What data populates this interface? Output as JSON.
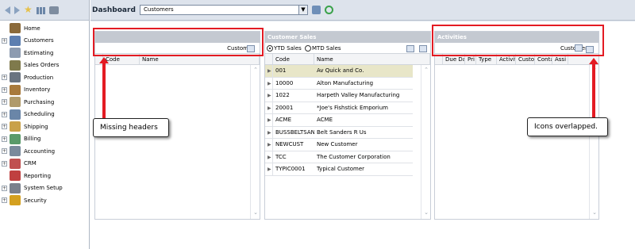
{
  "nav": {
    "items": [
      {
        "label": "Home",
        "expandable": false,
        "icon": "home-icon",
        "color": "#8b6a3a"
      },
      {
        "label": "Customers",
        "expandable": true,
        "icon": "customers-icon",
        "color": "#5e7fb0"
      },
      {
        "label": "Estimating",
        "expandable": false,
        "icon": "estimating-icon",
        "color": "#8d9bb0"
      },
      {
        "label": "Sales Orders",
        "expandable": false,
        "icon": "sales-orders-icon",
        "color": "#7f7a4c"
      },
      {
        "label": "Production",
        "expandable": true,
        "icon": "production-icon",
        "color": "#6a7480"
      },
      {
        "label": "Inventory",
        "expandable": true,
        "icon": "inventory-icon",
        "color": "#a87a3c"
      },
      {
        "label": "Purchasing",
        "expandable": true,
        "icon": "purchasing-icon",
        "color": "#b09a6a"
      },
      {
        "label": "Scheduling",
        "expandable": true,
        "icon": "scheduling-icon",
        "color": "#6a86a8"
      },
      {
        "label": "Shipping",
        "expandable": true,
        "icon": "shipping-icon",
        "color": "#c9a14a"
      },
      {
        "label": "Billing",
        "expandable": true,
        "icon": "billing-icon",
        "color": "#5a9a6a"
      },
      {
        "label": "Accounting",
        "expandable": true,
        "icon": "accounting-icon",
        "color": "#7a8a9c"
      },
      {
        "label": "CRM",
        "expandable": true,
        "icon": "crm-icon",
        "color": "#c05050"
      },
      {
        "label": "Reporting",
        "expandable": false,
        "icon": "reporting-icon",
        "color": "#c04040"
      },
      {
        "label": "System Setup",
        "expandable": true,
        "icon": "system-setup-icon",
        "color": "#7a808c"
      },
      {
        "label": "Security",
        "expandable": true,
        "icon": "security-icon",
        "color": "#d4a020"
      }
    ]
  },
  "header": {
    "title": "Dashboard",
    "select_value": "Customers"
  },
  "panel_left": {
    "title": "",
    "cols": [
      "Code",
      "Name"
    ],
    "tool_label": "Custom"
  },
  "panel_mid": {
    "title": "Customer Sales",
    "radio_ytd": "YTD Sales",
    "radio_mtd": "MTD Sales",
    "cols": [
      "Code",
      "Name"
    ],
    "rows": [
      {
        "code": "001",
        "name": "Av Quick and Co."
      },
      {
        "code": "10000",
        "name": "Alton Manufacturing"
      },
      {
        "code": "1022",
        "name": "Harpeth Valley Manufacturing"
      },
      {
        "code": "20001",
        "name": "*Joe's Fishstick Emporium"
      },
      {
        "code": "ACME",
        "name": "ACME"
      },
      {
        "code": "BUSSBELTSAN",
        "name": "Belt Sanders R Us"
      },
      {
        "code": "NEWCUST",
        "name": "New Customer"
      },
      {
        "code": "TCC",
        "name": "The Customer Corporation"
      },
      {
        "code": "TYPIC0001",
        "name": "Typical Customer"
      }
    ]
  },
  "panel_right": {
    "title": "Activities",
    "tool_label": "Customer",
    "cols": [
      "Due Dat",
      "Pri",
      "Type",
      "Activit",
      "Custor",
      "Conta",
      "Assi"
    ]
  },
  "annotations": {
    "left": "Missing headers",
    "right": "Icons overlapped."
  },
  "colors": {
    "annotation_red": "#e31b23",
    "selected_row": "#e8e6c8",
    "panel_title_bg": "#c4c9d1"
  }
}
